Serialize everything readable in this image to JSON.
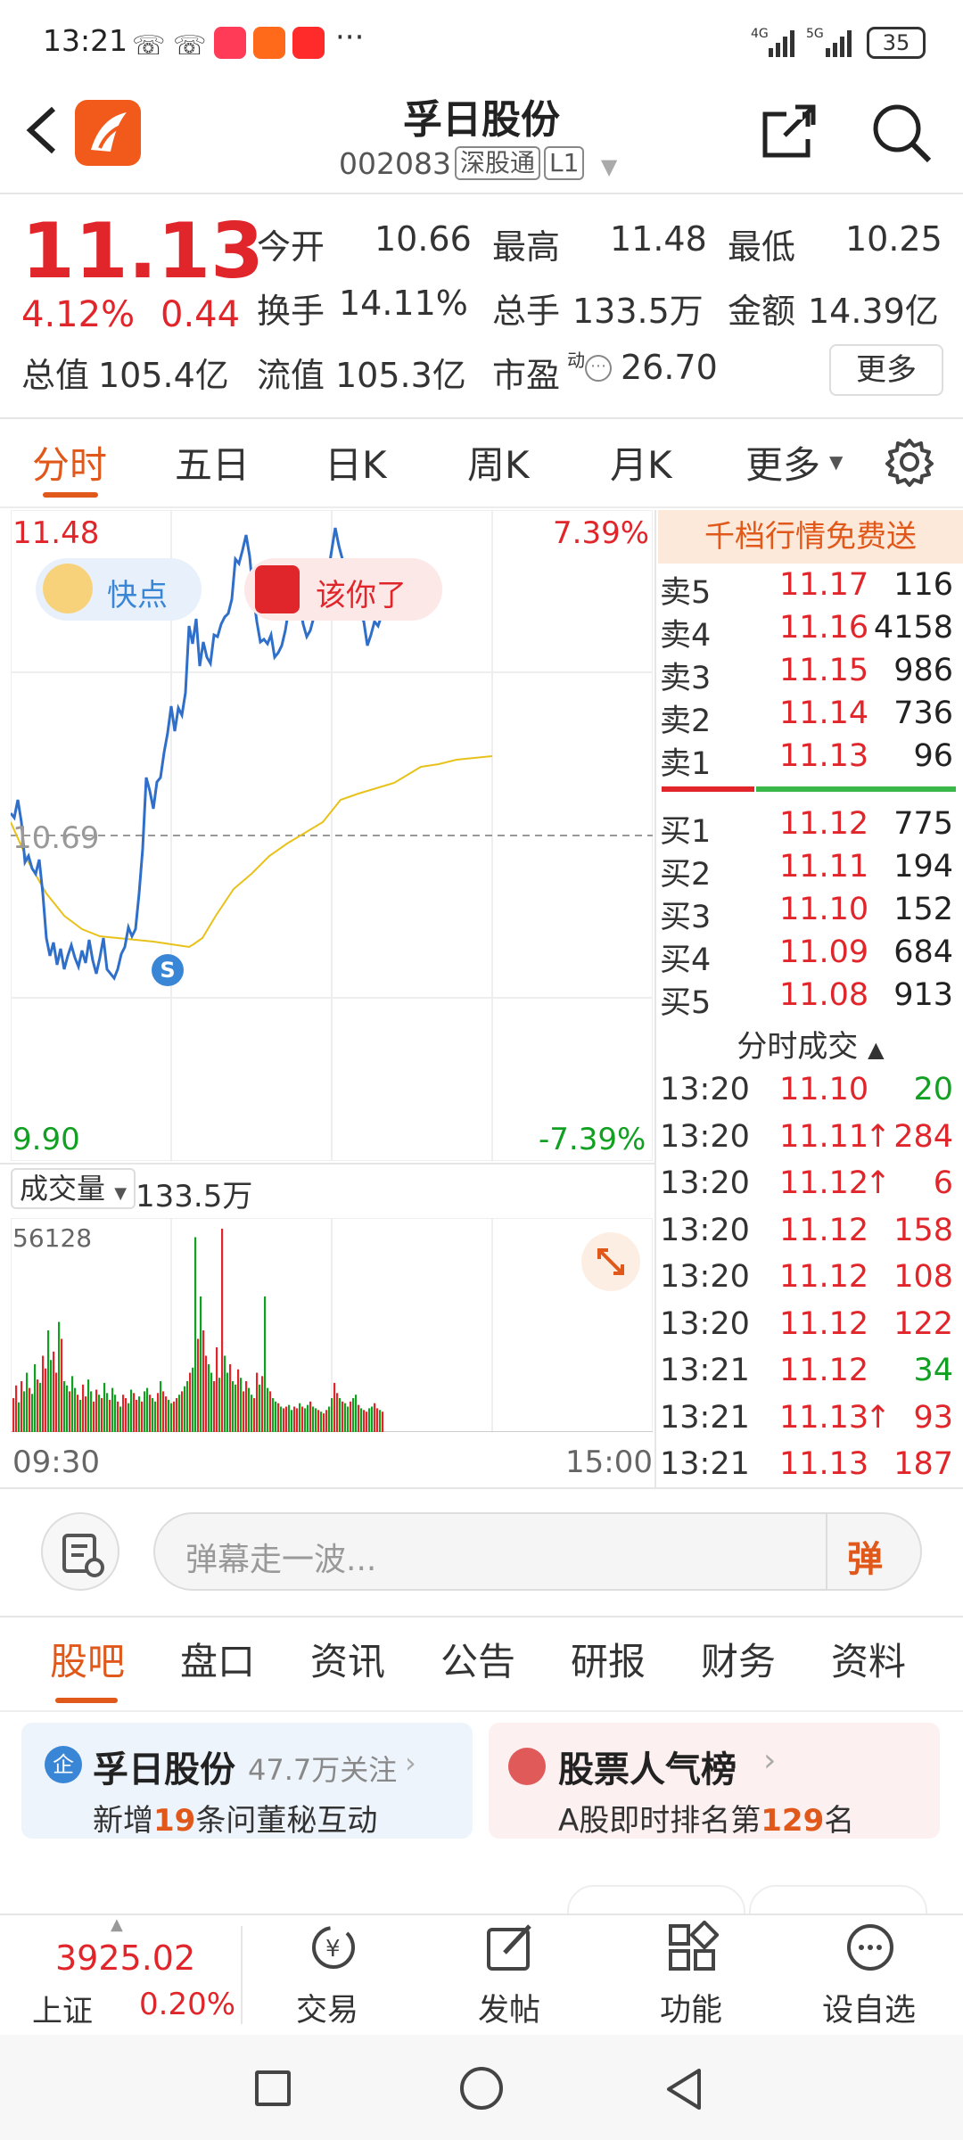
{
  "status": {
    "time": "13:21",
    "dots": "···",
    "battery": "35"
  },
  "header": {
    "title": "孚日股份",
    "code": "002083",
    "tag": "深股通",
    "level": "L1"
  },
  "quote": {
    "price": "11.13",
    "change_pct": "4.12%",
    "change": "0.44",
    "open_label": "今开",
    "open": "10.66",
    "high_label": "最高",
    "high": "11.48",
    "low_label": "最低",
    "low": "10.25",
    "turnover_label": "换手",
    "turnover": "14.11%",
    "volume_label": "总手",
    "volume": "133.5万",
    "amount_label": "金额",
    "amount": "14.39亿",
    "mcap_label": "总值",
    "mcap": "105.4亿",
    "float_label": "流值",
    "float": "105.3亿",
    "pe_label": "市盈",
    "pe_sup": "动",
    "pe": "26.70",
    "more": "更多"
  },
  "tabs": [
    "分时",
    "五日",
    "日K",
    "周K",
    "月K",
    "更多"
  ],
  "chart": {
    "price_high": "11.48",
    "price_low": "9.90",
    "pct_high": "7.39%",
    "pct_low": "-7.39%",
    "ref_price": "10.69",
    "btn_quick": "快点",
    "btn_you": "该你了",
    "marker": "S",
    "vol_label": "成交量",
    "vol_value": "133.5万",
    "vol_max": "56128",
    "time_start": "09:30",
    "time_end": "15:00"
  },
  "orderbook": {
    "banner": "千档行情免费送",
    "asks": [
      {
        "label": "卖5",
        "price": "11.17",
        "qty": "116"
      },
      {
        "label": "卖4",
        "price": "11.16",
        "qty": "4158"
      },
      {
        "label": "卖3",
        "price": "11.15",
        "qty": "986"
      },
      {
        "label": "卖2",
        "price": "11.14",
        "qty": "736"
      },
      {
        "label": "卖1",
        "price": "11.13",
        "qty": "96"
      }
    ],
    "bids": [
      {
        "label": "买1",
        "price": "11.12",
        "qty": "775"
      },
      {
        "label": "买2",
        "price": "11.11",
        "qty": "194"
      },
      {
        "label": "买3",
        "price": "11.10",
        "qty": "152"
      },
      {
        "label": "买4",
        "price": "11.09",
        "qty": "684"
      },
      {
        "label": "买5",
        "price": "11.08",
        "qty": "913"
      }
    ],
    "ticks_title": "分时成交",
    "ticks": [
      {
        "time": "13:20",
        "price": "11.10",
        "arrow": "",
        "qty": "20",
        "qty_color": "green"
      },
      {
        "time": "13:20",
        "price": "11.11",
        "arrow": "↑",
        "qty": "284",
        "qty_color": "red"
      },
      {
        "time": "13:20",
        "price": "11.12",
        "arrow": "↑",
        "qty": "6",
        "qty_color": "red"
      },
      {
        "time": "13:20",
        "price": "11.12",
        "arrow": "",
        "qty": "158",
        "qty_color": "red"
      },
      {
        "time": "13:20",
        "price": "11.12",
        "arrow": "",
        "qty": "108",
        "qty_color": "red"
      },
      {
        "time": "13:20",
        "price": "11.12",
        "arrow": "",
        "qty": "122",
        "qty_color": "red"
      },
      {
        "time": "13:21",
        "price": "11.12",
        "arrow": "",
        "qty": "34",
        "qty_color": "green"
      },
      {
        "time": "13:21",
        "price": "11.13",
        "arrow": "↑",
        "qty": "93",
        "qty_color": "red"
      },
      {
        "time": "13:21",
        "price": "11.13",
        "arrow": "",
        "qty": "187",
        "qty_color": "red"
      }
    ]
  },
  "danmaku": {
    "placeholder": "弹幕走一波...",
    "send": "弹"
  },
  "subtabs": [
    "股吧",
    "盘口",
    "资讯",
    "公告",
    "研报",
    "财务",
    "资料"
  ],
  "cards": {
    "left_icon": "企",
    "left_title": "孚日股份",
    "left_follow": "47.7万关注",
    "left_line_pre": "新增",
    "left_line_num": "19",
    "left_line_post": "条问董秘互动",
    "right_title": "股票人气榜",
    "right_line_pre": "A股即时排名第",
    "right_line_num": "129",
    "right_line_post": "名"
  },
  "bottom": {
    "index_value": "3925.02",
    "index_name": "上证",
    "index_pct": "0.20%",
    "nav": [
      "交易",
      "发帖",
      "功能",
      "设自选"
    ]
  },
  "colors": {
    "accent": "#e0581a",
    "up": "#e0262b",
    "down": "#12a022",
    "line": "#2f6fc9",
    "avg": "#e8c21a"
  }
}
